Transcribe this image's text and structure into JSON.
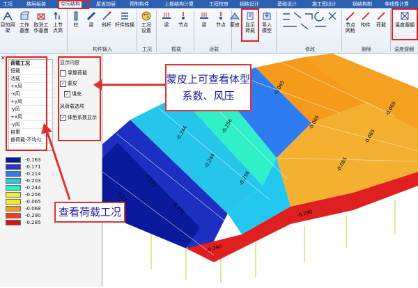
{
  "tabs": [
    {
      "label": "工况",
      "active": false
    },
    {
      "label": "楼层组装",
      "active": false
    },
    {
      "label": "空间结构",
      "active": true
    },
    {
      "label": "屋盖加层",
      "active": false
    },
    {
      "label": "预制构件",
      "active": false
    },
    {
      "label": "上部结构计算",
      "active": false
    },
    {
      "label": "工程校审",
      "active": false
    },
    {
      "label": "钢结设计",
      "active": false
    },
    {
      "label": "基础设计",
      "active": false
    },
    {
      "label": "施工图设计",
      "active": false
    },
    {
      "label": "钢结构制",
      "active": false
    },
    {
      "label": "非线性计算",
      "active": false
    }
  ],
  "ribbon": {
    "buttons": [
      {
        "label": "目的网架"
      },
      {
        "label": "工作 基面"
      },
      {
        "label": "取消工 作基面"
      },
      {
        "label": "上节 点高"
      },
      {
        "label": "柱"
      },
      {
        "label": "梁"
      },
      {
        "label": "斜杆"
      },
      {
        "label": "杆件转换"
      },
      {
        "label": "工况 设置"
      },
      {
        "label": "梁"
      },
      {
        "label": "节点"
      },
      {
        "label": "梁"
      },
      {
        "label": "节点"
      },
      {
        "label": "蒙皮"
      },
      {
        "label": "显示 荷载"
      },
      {
        "label": "导入 模型"
      },
      {
        "label": "节点 网格"
      },
      {
        "label": "构件"
      },
      {
        "label": "荷载"
      },
      {
        "label": "温度遛绷"
      }
    ],
    "groups": [
      "构件输入",
      "工况",
      "框载",
      "活载",
      "修改",
      "删除",
      "温度遛绷"
    ]
  },
  "cases": {
    "title": "荷载工况",
    "items": [
      "恒载",
      "活载",
      "+x风",
      "-x风",
      "+y风",
      "-y风",
      "+x风",
      "-y风",
      "自重",
      "普荷载-不均匀"
    ]
  },
  "display": {
    "title": "显示内容",
    "items": [
      {
        "label": "导算荷载",
        "checked": false
      },
      {
        "label": "蒙皮",
        "checked": true
      },
      {
        "label": "填充",
        "checked": true
      }
    ],
    "wind_label": "风荷载选项",
    "wind_option": {
      "label": "体型系数显示",
      "checked": true
    }
  },
  "legend": [
    {
      "value": "-0.163",
      "color": "#0a1a9a"
    },
    {
      "value": "-0.171",
      "color": "#1f3ad6"
    },
    {
      "value": "-0.214",
      "color": "#2f7cf2"
    },
    {
      "value": "-0.203",
      "color": "#22c8f0"
    },
    {
      "value": "-0.244",
      "color": "#2ff0c8"
    },
    {
      "value": "-0.256",
      "color": "#e8f03a"
    },
    {
      "value": "-0.065",
      "color": "#f4e81e"
    },
    {
      "value": "-0.068",
      "color": "#f59a1a"
    },
    {
      "value": "-0.290",
      "color": "#e8431c"
    },
    {
      "value": "-0.285",
      "color": "#d01818"
    }
  ],
  "callouts": {
    "top": "蒙皮上可查看体型系数、风压",
    "bottom": "查看荷载工况"
  },
  "model_labels": {
    "blue": "-0.171",
    "cyan": "-0.244",
    "teal": "-0.256",
    "orange": "-0.065",
    "red": "-0.290"
  }
}
